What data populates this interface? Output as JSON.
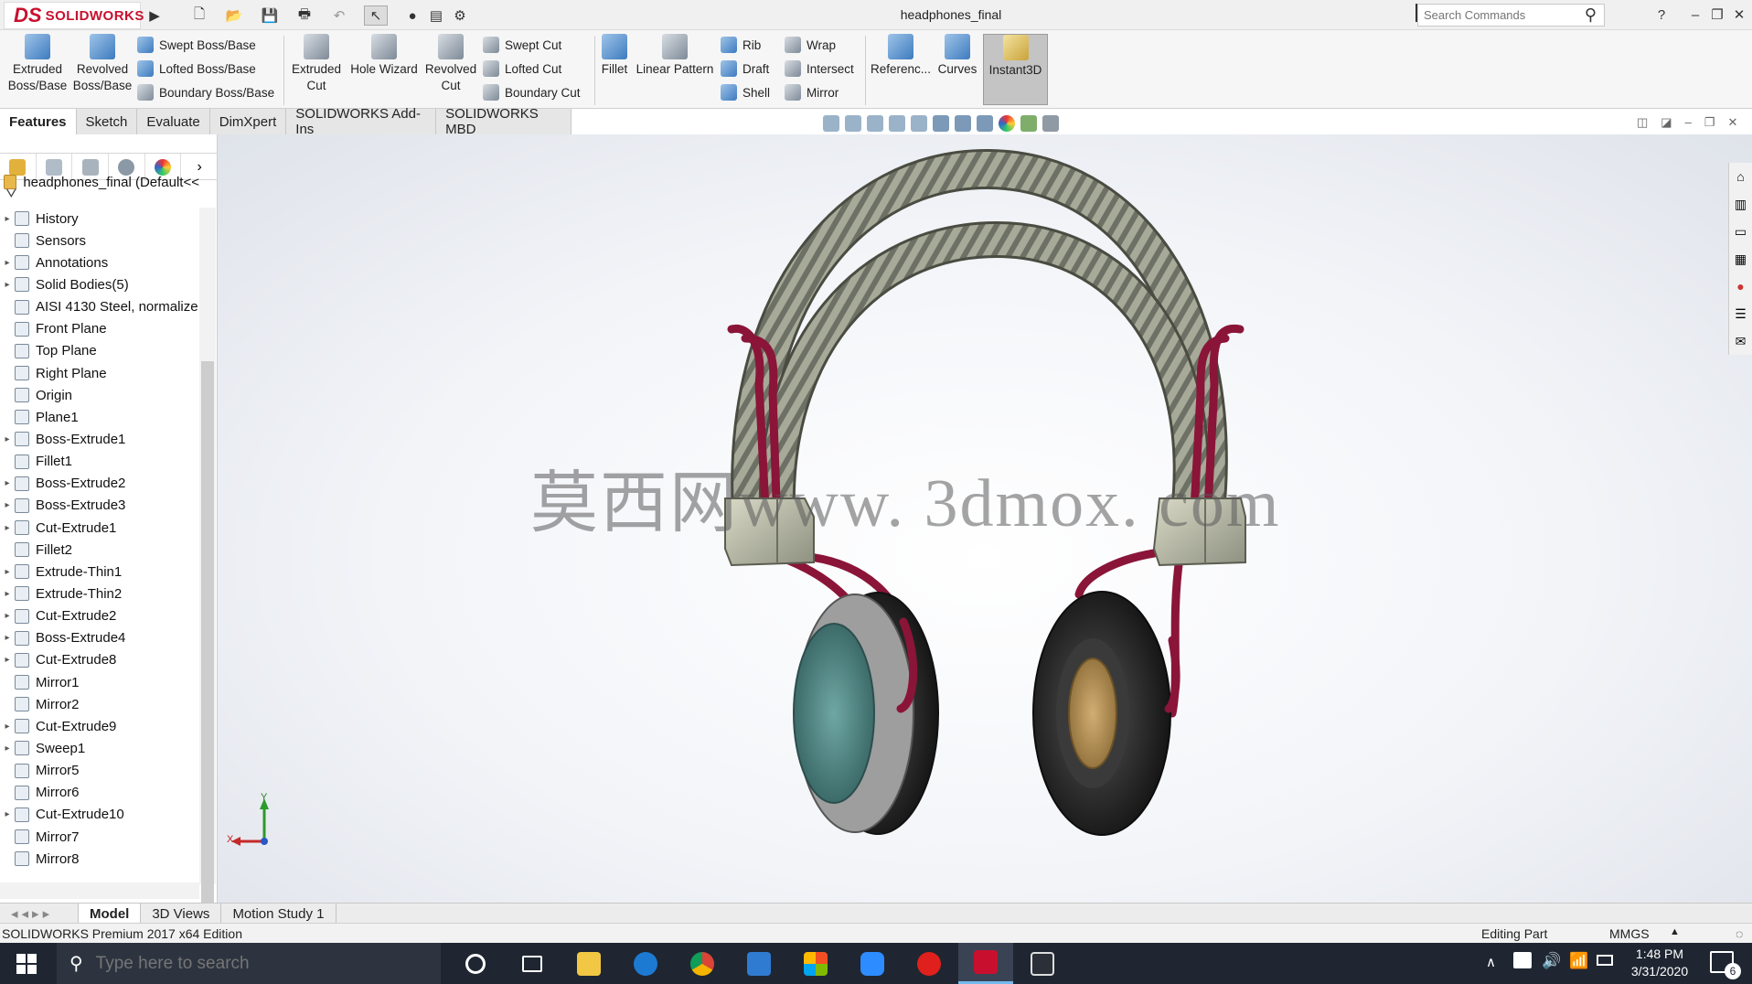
{
  "app": {
    "brand_mark": "DS",
    "brand_name": "SOLIDWORKS",
    "document_title": "headphones_final",
    "search_placeholder": "Search Commands",
    "help": "?"
  },
  "command_manager": {
    "big_tools": [
      {
        "label1": "Extruded",
        "label2": "Boss/Base"
      },
      {
        "label1": "Revolved",
        "label2": "Boss/Base"
      },
      {
        "label1": "Extruded",
        "label2": "Cut"
      },
      {
        "label1": "Hole Wizard",
        "label2": ""
      },
      {
        "label1": "Revolved",
        "label2": "Cut"
      },
      {
        "label1": "Fillet",
        "label2": ""
      },
      {
        "label1": "Linear Pattern",
        "label2": ""
      },
      {
        "label1": "Referenc...",
        "label2": ""
      },
      {
        "label1": "Curves",
        "label2": ""
      },
      {
        "label1": "Instant3D",
        "label2": ""
      }
    ],
    "small_tools": [
      "Swept Boss/Base",
      "Lofted Boss/Base",
      "Boundary Boss/Base",
      "Swept Cut",
      "Lofted Cut",
      "Boundary Cut",
      "Rib",
      "Draft",
      "Shell",
      "Wrap",
      "Intersect",
      "Mirror"
    ]
  },
  "tabs": [
    "Features",
    "Sketch",
    "Evaluate",
    "DimXpert",
    "SOLIDWORKS Add-Ins",
    "SOLIDWORKS MBD"
  ],
  "feature_tree": {
    "root": "headphones_final  (Default<<",
    "items": [
      "History",
      "Sensors",
      "Annotations",
      "Solid Bodies(5)",
      "AISI 4130 Steel, normalize",
      "Front Plane",
      "Top Plane",
      "Right Plane",
      "Origin",
      "Plane1",
      "Boss-Extrude1",
      "Fillet1",
      "Boss-Extrude2",
      "Boss-Extrude3",
      "Cut-Extrude1",
      "Fillet2",
      "Extrude-Thin1",
      "Extrude-Thin2",
      "Cut-Extrude2",
      "Boss-Extrude4",
      "Cut-Extrude8",
      "Mirror1",
      "Mirror2",
      "Cut-Extrude9",
      "Sweep1",
      "Mirror5",
      "Mirror6",
      "Cut-Extrude10",
      "Mirror7",
      "Mirror8"
    ]
  },
  "watermark": "莫西网www. 3dmox. com",
  "triad": {
    "y": "Y",
    "x": "X"
  },
  "bottom_tabs": [
    "Model",
    "3D Views",
    "Motion Study 1"
  ],
  "status": {
    "edition": "SOLIDWORKS Premium 2017 x64 Edition",
    "mode": "Editing Part",
    "units": "MMGS"
  },
  "taskbar": {
    "search_placeholder": "Type here to search",
    "time": "1:48 PM",
    "date": "3/31/2020",
    "notification_count": "6"
  },
  "colors": {
    "brand_red": "#c8102e",
    "headband": "#8f9284",
    "wire": "#8a1538",
    "cushion": "#2a2a2a",
    "ear_mesh": "#4f8c8a",
    "ear_felt": "#b08d57",
    "taskbar": "#1f2632"
  }
}
